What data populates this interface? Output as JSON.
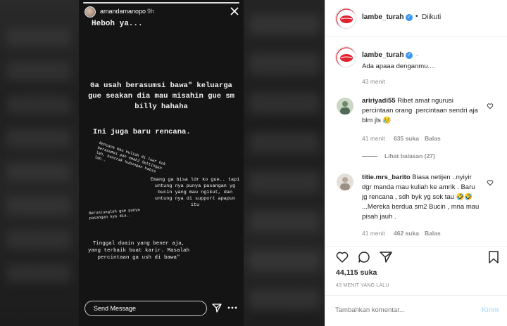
{
  "story": {
    "username": "amandamanopo",
    "time": "9h",
    "lines": {
      "l1": "Heboh ya...",
      "l2": "Ga usah berasumsi  bawa\" keluarga gue seakan dia mau misahin gue sm billy hahaha",
      "l3": "Ini juga baru rencana.",
      "l4": "Rencana mau kuliah di luar kok berasumsi pah emah2 Settingan lah, kontrak hubungan habis lah..",
      "l5": "Emang ga bisa ldr ko gue.. tapi untung nya punya pasangan yg bucin yang mau ngikut, dan untung nya di support apapun itu",
      "l6": "Beruntunglah gue punya pasangan kya dia..",
      "l7": "Tinggal doain yang bener aja, yang terbaik buat karir. Masalah percintaan ga ush di bawa\""
    },
    "message_placeholder": "Send Message"
  },
  "post": {
    "author": "lambe_turah",
    "follow_status": "Diikuti",
    "caption_author": "lambe_turah",
    "caption_suffix": ".",
    "caption_text": "Ada apaaa denganmu....",
    "caption_time": "43 menit",
    "comments": [
      {
        "user": "aririyadi55",
        "text": "Ribet amat ngurusi percintaan orang .percintaan sendri aja blm jls 😥",
        "time": "41 menit",
        "likes": "635 suka",
        "reply": "Balas",
        "view_replies": "Lihat balasan (27)"
      },
      {
        "user": "titie.mrs_barito",
        "text": "Biasa netijen ..nyiyir dgr manda mau kuliah ke amrik . Baru jg rencana , sdh byk yg sok tau 🤣🤣 ...Mereka berdua sm2 Bucin , mna mau pisah jauh .",
        "time": "41 menit",
        "likes": "462 suka",
        "reply": "Balas"
      }
    ],
    "likes_count": "44,115 suka",
    "posted_ago": "43 MENIT YANG LALU",
    "comment_placeholder": "Tambahkan komentar...",
    "post_button": "Kirim"
  },
  "colors": {
    "verified_blue": "#3897f0",
    "post_button_disabled": "#b2dffc",
    "lip_red": "#e0242f"
  }
}
